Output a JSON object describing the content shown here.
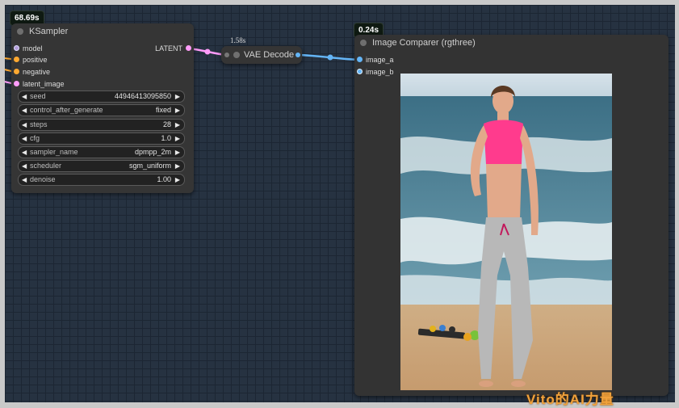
{
  "ksampler": {
    "time": "68.69s",
    "title": "KSampler",
    "inputs": [
      "model",
      "positive",
      "negative",
      "latent_image"
    ],
    "output": "LATENT",
    "widgets": [
      {
        "name": "seed",
        "value": "44946413095850"
      },
      {
        "name": "control_after_generate",
        "value": "fixed"
      },
      {
        "name": "steps",
        "value": "28"
      },
      {
        "name": "cfg",
        "value": "1.0"
      },
      {
        "name": "sampler_name",
        "value": "dpmpp_2m"
      },
      {
        "name": "scheduler",
        "value": "sgm_uniform"
      },
      {
        "name": "denoise",
        "value": "1.00"
      }
    ]
  },
  "vae_decode": {
    "time": "1.58s",
    "title": "VAE Decode"
  },
  "image_comparer": {
    "time": "0.24s",
    "title": "Image Comparer (rgthree)",
    "inputs": [
      "image_a",
      "image_b"
    ]
  },
  "watermark": "Vito的AI力量",
  "colors": {
    "canvas": "#263241",
    "node": "#353535",
    "latent_link": "#ff9cf9",
    "image_link": "#64b5f6",
    "model_pin": "#b39ddb",
    "conditioning_pin": "#ffa931"
  }
}
